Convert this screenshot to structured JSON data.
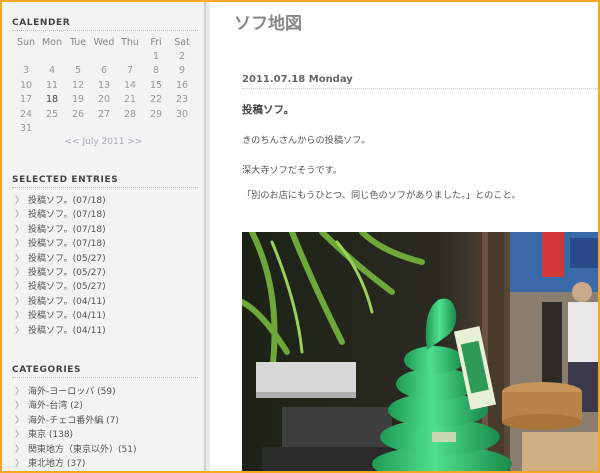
{
  "sidebar": {
    "calendar": {
      "heading": "CALENDER",
      "weekdays": [
        "Sun",
        "Mon",
        "Tue",
        "Wed",
        "Thu",
        "Fri",
        "Sat"
      ],
      "weeks": [
        [
          "",
          "",
          "",
          "",
          "",
          "1",
          "2"
        ],
        [
          "3",
          "4",
          "5",
          "6",
          "7",
          "8",
          "9"
        ],
        [
          "10",
          "11",
          "12",
          "13",
          "14",
          "15",
          "16"
        ],
        [
          "17",
          "18",
          "19",
          "20",
          "21",
          "22",
          "23"
        ],
        [
          "24",
          "25",
          "26",
          "27",
          "28",
          "29",
          "30"
        ],
        [
          "31",
          "",
          "",
          "",
          "",
          "",
          ""
        ]
      ],
      "highlighted_day": "18",
      "nav_prev": "<<",
      "nav_label": "July 2011",
      "nav_next": ">>"
    },
    "entries": {
      "heading": "SELECTED ENTRIES",
      "items": [
        "投稿ソフ。(07/18)",
        "投稿ソフ。(07/18)",
        "投稿ソフ。(07/18)",
        "投稿ソフ。(07/18)",
        "投稿ソフ。(05/27)",
        "投稿ソフ。(05/27)",
        "投稿ソフ。(05/27)",
        "投稿ソフ。(04/11)",
        "投稿ソフ。(04/11)",
        "投稿ソフ。(04/11)"
      ]
    },
    "categories": {
      "heading": "CATEGORIES",
      "items": [
        "海外-ヨーロッパ (59)",
        "海外-台湾 (2)",
        "海外-チェコ番外編 (7)",
        "東京 (138)",
        "関東地方（東京以外）(51)",
        "東北地方 (37)"
      ]
    },
    "arrow_glyph": "〉"
  },
  "main": {
    "blog_title": "ソフ地図",
    "post": {
      "date": "2011.07.18 Monday",
      "title": "投稿ソフ。",
      "lines": [
        "きのちんさんからの投稿ソフ。",
        "深大寺ソフだそうです。",
        "「別のお店にもうひとつ、同じ色のソフがありました。」とのこと。"
      ]
    }
  },
  "colors": {
    "border_orange": "#f5a623",
    "sidebar_bg": "#f3f3f3",
    "soft_serve_green": "#3ec97a"
  }
}
